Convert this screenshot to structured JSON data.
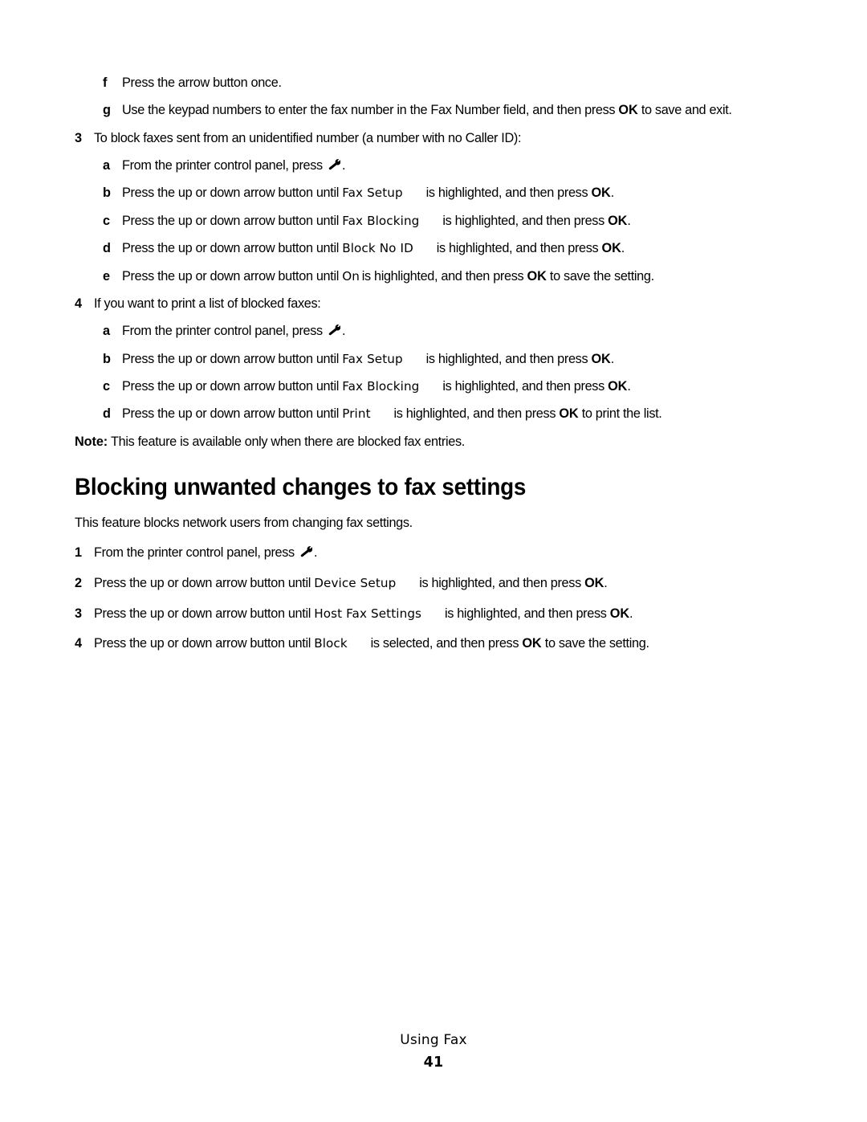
{
  "document": {
    "footer_title": "Using Fax",
    "page_number": "41",
    "icon_name": "wrench-icon"
  },
  "continued_steps": [
    {
      "marker": "f",
      "level": 2,
      "parts": [
        {
          "type": "text",
          "text": "Press the arrow button once."
        }
      ]
    },
    {
      "marker": "g",
      "level": 2,
      "parts": [
        {
          "type": "text",
          "text": "Use the keypad numbers to enter the fax number in the Fax Number field, and then press "
        },
        {
          "type": "bold",
          "text": "OK"
        },
        {
          "type": "text",
          "text": " to save and exit."
        }
      ]
    }
  ],
  "step3": {
    "marker": "3",
    "level": 1,
    "text": "To block faxes sent from an unidentified number (a number with no Caller ID):",
    "substeps": [
      {
        "marker": "a",
        "parts": [
          {
            "type": "text",
            "text": "From the printer control panel, press "
          },
          {
            "type": "icon",
            "icon": "wrench-icon"
          },
          {
            "type": "text",
            "text": "."
          }
        ]
      },
      {
        "marker": "b",
        "parts": [
          {
            "type": "text",
            "text": "Press the up or down arrow button until "
          },
          {
            "type": "menu",
            "text": "Fax Setup"
          },
          {
            "type": "text",
            "text": "is highlighted, and then press "
          },
          {
            "type": "bold",
            "text": "OK"
          },
          {
            "type": "text",
            "text": "."
          }
        ]
      },
      {
        "marker": "c",
        "parts": [
          {
            "type": "text",
            "text": "Press the up or down arrow button until "
          },
          {
            "type": "menu",
            "text": "Fax Blocking"
          },
          {
            "type": "text",
            "text": "is highlighted, and then press "
          },
          {
            "type": "bold",
            "text": "OK"
          },
          {
            "type": "text",
            "text": "."
          }
        ]
      },
      {
        "marker": "d",
        "parts": [
          {
            "type": "text",
            "text": "Press the up or down arrow button until "
          },
          {
            "type": "menu",
            "text": "Block No ID"
          },
          {
            "type": "text",
            "text": "is highlighted, and then press "
          },
          {
            "type": "bold",
            "text": "OK"
          },
          {
            "type": "text",
            "text": "."
          }
        ]
      },
      {
        "marker": "e",
        "parts": [
          {
            "type": "text",
            "text": "Press the up or down arrow button until "
          },
          {
            "type": "menu-nogap",
            "text": "On"
          },
          {
            "type": "text",
            "text": "is highlighted, and then press "
          },
          {
            "type": "bold",
            "text": "OK"
          },
          {
            "type": "text",
            "text": " to save the setting."
          }
        ]
      }
    ]
  },
  "step4": {
    "marker": "4",
    "level": 1,
    "text": "If you want to print a list of blocked faxes:",
    "substeps": [
      {
        "marker": "a",
        "parts": [
          {
            "type": "text",
            "text": "From the printer control panel, press "
          },
          {
            "type": "icon",
            "icon": "wrench-icon"
          },
          {
            "type": "text",
            "text": "."
          }
        ]
      },
      {
        "marker": "b",
        "parts": [
          {
            "type": "text",
            "text": "Press the up or down arrow button until "
          },
          {
            "type": "menu",
            "text": "Fax Setup"
          },
          {
            "type": "text",
            "text": "is highlighted, and then press "
          },
          {
            "type": "bold",
            "text": "OK"
          },
          {
            "type": "text",
            "text": "."
          }
        ]
      },
      {
        "marker": "c",
        "parts": [
          {
            "type": "text",
            "text": "Press the up or down arrow button until "
          },
          {
            "type": "menu",
            "text": "Fax Blocking"
          },
          {
            "type": "text",
            "text": "is highlighted, and then press "
          },
          {
            "type": "bold",
            "text": "OK"
          },
          {
            "type": "text",
            "text": "."
          }
        ]
      },
      {
        "marker": "d",
        "parts": [
          {
            "type": "text",
            "text": "Press the up or down arrow button until "
          },
          {
            "type": "menu",
            "text": "Print"
          },
          {
            "type": "text",
            "text": "is highlighted, and then press "
          },
          {
            "type": "bold",
            "text": "OK"
          },
          {
            "type": "text",
            "text": " to print the list."
          }
        ]
      }
    ]
  },
  "note": {
    "label": "Note:",
    "text": " This feature is available only when there are blocked fax entries."
  },
  "section": {
    "heading": "Blocking unwanted changes to fax settings",
    "intro": "This feature blocks network users from changing fax settings.",
    "steps": [
      {
        "marker": "1",
        "parts": [
          {
            "type": "text",
            "text": "From the printer control panel, press "
          },
          {
            "type": "icon",
            "icon": "wrench-icon"
          },
          {
            "type": "text",
            "text": "."
          }
        ]
      },
      {
        "marker": "2",
        "parts": [
          {
            "type": "text",
            "text": "Press the up or down arrow button until "
          },
          {
            "type": "menu",
            "text": "Device Setup"
          },
          {
            "type": "text",
            "text": "is highlighted, and then press "
          },
          {
            "type": "bold",
            "text": "OK"
          },
          {
            "type": "text",
            "text": "."
          }
        ]
      },
      {
        "marker": "3",
        "parts": [
          {
            "type": "text",
            "text": "Press the up or down arrow button until "
          },
          {
            "type": "menu",
            "text": "Host Fax Settings"
          },
          {
            "type": "text",
            "text": "is highlighted, and then press "
          },
          {
            "type": "bold",
            "text": "OK"
          },
          {
            "type": "text",
            "text": "."
          }
        ]
      },
      {
        "marker": "4",
        "parts": [
          {
            "type": "text",
            "text": "Press the up or down arrow button until "
          },
          {
            "type": "menu",
            "text": "Block"
          },
          {
            "type": "text",
            "text": "is selected, and then press "
          },
          {
            "type": "bold",
            "text": "OK"
          },
          {
            "type": "text",
            "text": " to save the setting."
          }
        ]
      }
    ]
  }
}
